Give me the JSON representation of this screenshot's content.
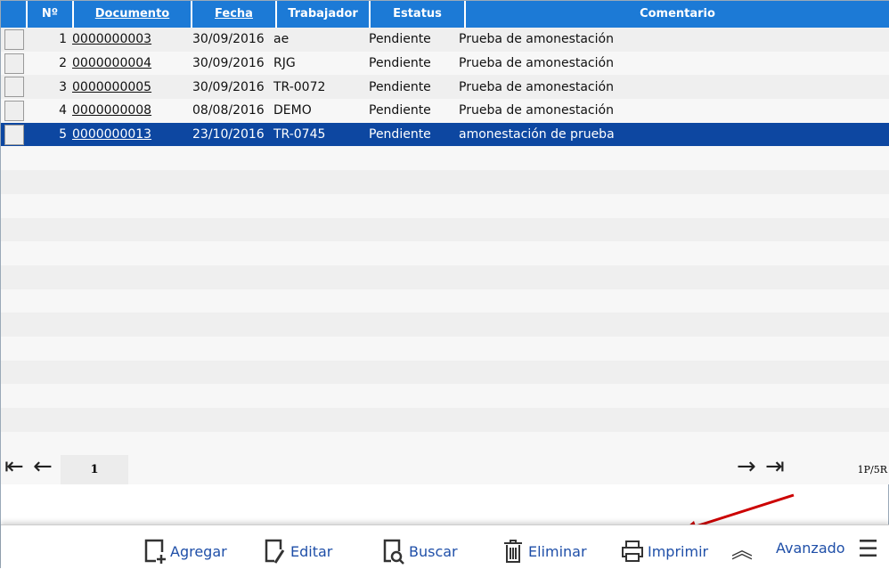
{
  "columns": {
    "no": "Nº",
    "documento": "Documento",
    "fecha": "Fecha",
    "trabajador": "Trabajador",
    "estatus": "Estatus",
    "comentario": "Comentario"
  },
  "rows": [
    {
      "no": "1",
      "documento": "0000000003",
      "fecha": "30/09/2016",
      "trabajador": "ae",
      "estatus": "Pendiente",
      "comentario": "Prueba de amonestación"
    },
    {
      "no": "2",
      "documento": "0000000004",
      "fecha": "30/09/2016",
      "trabajador": "RJG",
      "estatus": "Pendiente",
      "comentario": "Prueba de amonestación"
    },
    {
      "no": "3",
      "documento": "0000000005",
      "fecha": "30/09/2016",
      "trabajador": "TR-0072",
      "estatus": "Pendiente",
      "comentario": "Prueba de amonestación"
    },
    {
      "no": "4",
      "documento": "0000000008",
      "fecha": "08/08/2016",
      "trabajador": "DEMO",
      "estatus": "Pendiente",
      "comentario": "Prueba de amonestación"
    },
    {
      "no": "5",
      "documento": "0000000013",
      "fecha": "23/10/2016",
      "trabajador": "TR-0745",
      "estatus": "Pendiente",
      "comentario": "amonestación de prueba"
    }
  ],
  "pager": {
    "page": "1",
    "info": "1P/5R"
  },
  "toolbar": {
    "agregar": "Agregar",
    "editar": "Editar",
    "buscar": "Buscar",
    "eliminar": "Eliminar",
    "imprimir": "Imprimir",
    "avanzado": "Avanzado"
  }
}
